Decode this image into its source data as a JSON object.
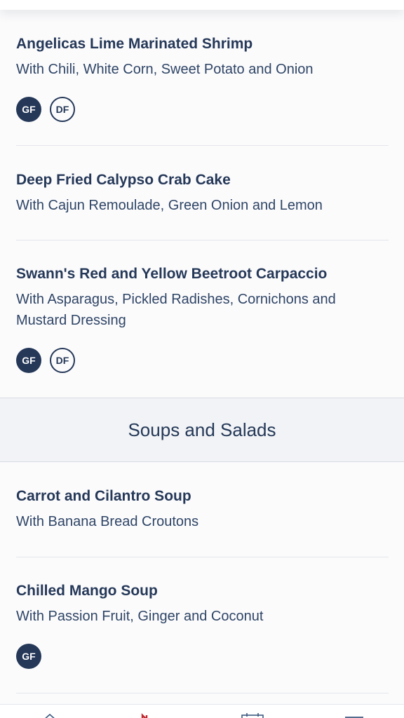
{
  "menu": {
    "items": [
      {
        "title": "Angelicas Lime Marinated Shrimp",
        "description": "With Chili, White Corn, Sweet Potato and Onion",
        "badges": [
          {
            "label": "GF",
            "style": "filled"
          },
          {
            "label": "DF",
            "style": "outline"
          }
        ]
      },
      {
        "title": "Deep Fried Calypso Crab Cake",
        "description": "With Cajun Remoulade, Green Onion and Lemon",
        "badges": []
      },
      {
        "title": "Swann's Red and Yellow Beetroot Carpaccio",
        "description": "With Asparagus, Pickled Radishes, Cornichons and Mustard Dressing",
        "badges": [
          {
            "label": "GF",
            "style": "filled"
          },
          {
            "label": "DF",
            "style": "outline"
          }
        ]
      }
    ],
    "section": {
      "title": "Soups and Salads",
      "items": [
        {
          "title": "Carrot and Cilantro Soup",
          "description": "With Banana Bread Croutons",
          "badges": []
        },
        {
          "title": "Chilled Mango Soup",
          "description": "With Passion Fruit, Ginger and Coconut",
          "badges": [
            {
              "label": "GF",
              "style": "filled"
            }
          ]
        }
      ]
    }
  },
  "bottom_nav": {
    "icons": [
      "home-icon",
      "dining-icon",
      "calendar-icon",
      "menu-icon"
    ]
  },
  "colors": {
    "primary_text": "#253858",
    "badge_fill": "#253858",
    "accent_red": "#c0262d",
    "section_bg": "#f1f3f6",
    "divider": "#e3e6ea"
  }
}
